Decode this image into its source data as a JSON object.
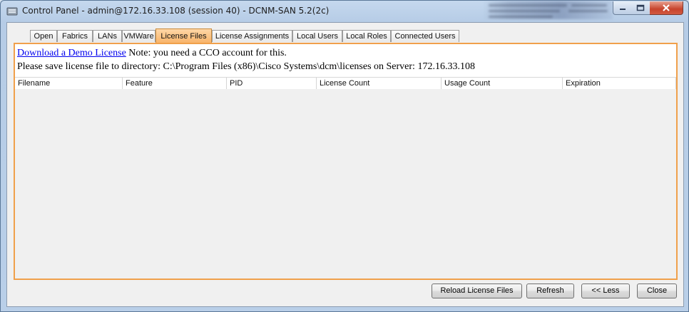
{
  "window": {
    "title": "Control Panel - admin@172.16.33.108 (session 40) - DCNM-SAN 5.2(2c)"
  },
  "tabs": [
    {
      "label": "Open",
      "active": false
    },
    {
      "label": "Fabrics",
      "active": false
    },
    {
      "label": "LANs",
      "active": false
    },
    {
      "label": "VMWare",
      "active": false
    },
    {
      "label": "License Files",
      "active": true
    },
    {
      "label": "License Assignments",
      "active": false
    },
    {
      "label": "Local Users",
      "active": false
    },
    {
      "label": "Local Roles",
      "active": false
    },
    {
      "label": "Connected Users",
      "active": false
    }
  ],
  "info": {
    "link_text": "Download a Demo License",
    "note": " Note: you need a CCO account for this.",
    "save_path_line": "Please save license file to directory: C:\\Program Files (x86)\\Cisco Systems\\dcm\\licenses on Server: 172.16.33.108"
  },
  "table": {
    "columns": [
      "Filename",
      "Feature",
      "PID",
      "License Count",
      "Usage Count",
      "Expiration"
    ],
    "rows": []
  },
  "buttons": {
    "reload": "Reload License Files",
    "refresh": "Refresh",
    "less": "<< Less",
    "close": "Close"
  },
  "icons": {
    "app": "server-icon",
    "minimize": "minimize-icon",
    "maximize": "maximize-icon",
    "close": "close-icon"
  },
  "colors": {
    "active_tab": "#f8b46a",
    "panel_border": "#f0a04b",
    "link": "#0000ee",
    "close_button": "#c7432c"
  }
}
